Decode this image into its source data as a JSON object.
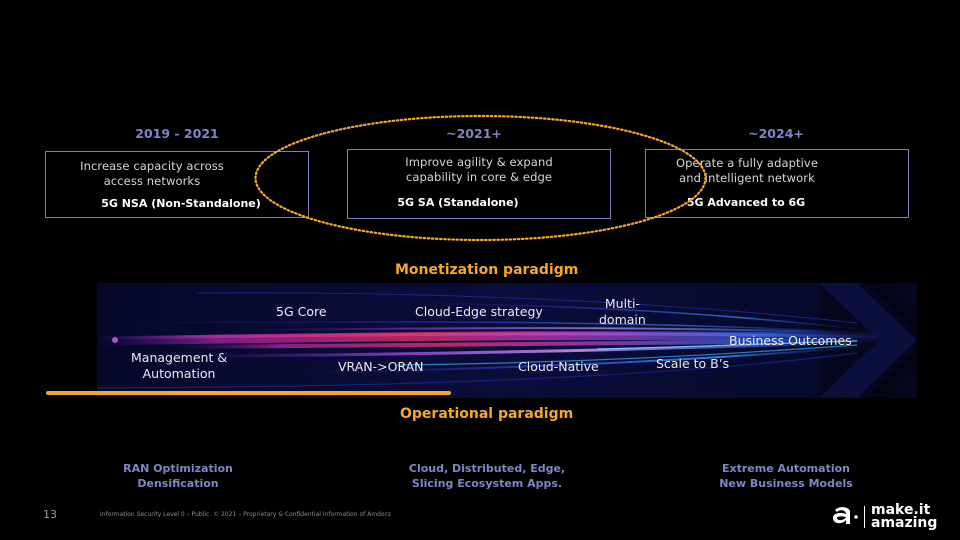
{
  "slide": {
    "page_number": "13",
    "legal_notice": "Information Security Level 0 – Public. © 2021 – Proprietary & Confidential Information of Amdocs"
  },
  "phases": [
    {
      "period": "2019 - 2021",
      "description": "Increase capacity across access networks",
      "description_lines": [
        "Increase capacity across",
        "access networks"
      ],
      "tag": "5G NSA (Non-Standalone)"
    },
    {
      "period": "~2021+",
      "description": "Improve agility & expand capability in core & edge",
      "description_lines": [
        "Improve agility & expand",
        "capability in core & edge"
      ],
      "tag": "5G SA (Standalone)"
    },
    {
      "period": "~2024+",
      "description": "Operate a fully adaptive and intelligent network",
      "description_lines": [
        "Operate a fully adaptive",
        "and intelligent network"
      ],
      "tag": "5G Advanced to 6G"
    }
  ],
  "paradigms": {
    "monetization": "Monetization paradigm",
    "operational": "Operational paradigm"
  },
  "banner_labels": {
    "core": "5G Core",
    "cloud_edge": "Cloud-Edge strategy",
    "multi_domain_1": "Multi-",
    "multi_domain_2": "domain",
    "business_outcomes": "Business Outcomes",
    "management_1": "Management &",
    "management_2": "Automation",
    "vran": "VRAN->ORAN",
    "cloud_native": "Cloud-Native",
    "scale": "Scale to B’s"
  },
  "outcomes": [
    {
      "lines": [
        "RAN Optimization",
        "Densification"
      ]
    },
    {
      "lines": [
        "Cloud, Distributed, Edge,",
        "Slicing Ecosystem Apps."
      ]
    },
    {
      "lines": [
        "Extreme Automation",
        "New Business Models"
      ]
    }
  ],
  "logo": {
    "mark": "a·",
    "tagline_1": "make.it",
    "tagline_2": "amazing"
  },
  "colors": {
    "background": "#000000",
    "accent_orange": "#f7a823",
    "period_blue": "#7f86c4",
    "box_border": "#7b80b8"
  }
}
